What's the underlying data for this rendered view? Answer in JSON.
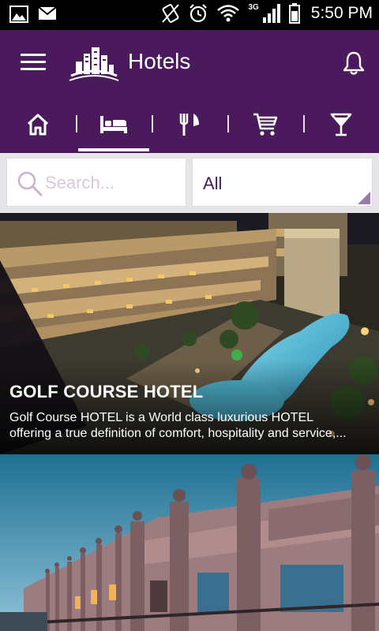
{
  "status_bar": {
    "network": "3G",
    "time": "5:50 PM",
    "icons": [
      "image-icon",
      "mail-icon",
      "vibrate-icon",
      "alarm-icon",
      "wifi-icon",
      "signal-icon",
      "battery-icon"
    ]
  },
  "app_bar": {
    "title": "Hotels",
    "colors": {
      "primary": "#4b1a5c",
      "accent": "#ffffff"
    }
  },
  "categories": [
    {
      "icon": "home-icon",
      "active": false
    },
    {
      "icon": "bed-icon",
      "active": true
    },
    {
      "icon": "restaurant-icon",
      "active": false
    },
    {
      "icon": "cart-icon",
      "active": false
    },
    {
      "icon": "cocktail-icon",
      "active": false
    }
  ],
  "search": {
    "placeholder": "Search...",
    "value": ""
  },
  "filter": {
    "selected": "All"
  },
  "listings": [
    {
      "title": "GOLF COURSE HOTEL",
      "description_line1": "Golf Course HOTEL is a World class luxurious HOTEL",
      "description_line2": "offering a true definition of comfort, hospitality and service,..."
    },
    {
      "title": "",
      "description_line1": "",
      "description_line2": ""
    }
  ]
}
